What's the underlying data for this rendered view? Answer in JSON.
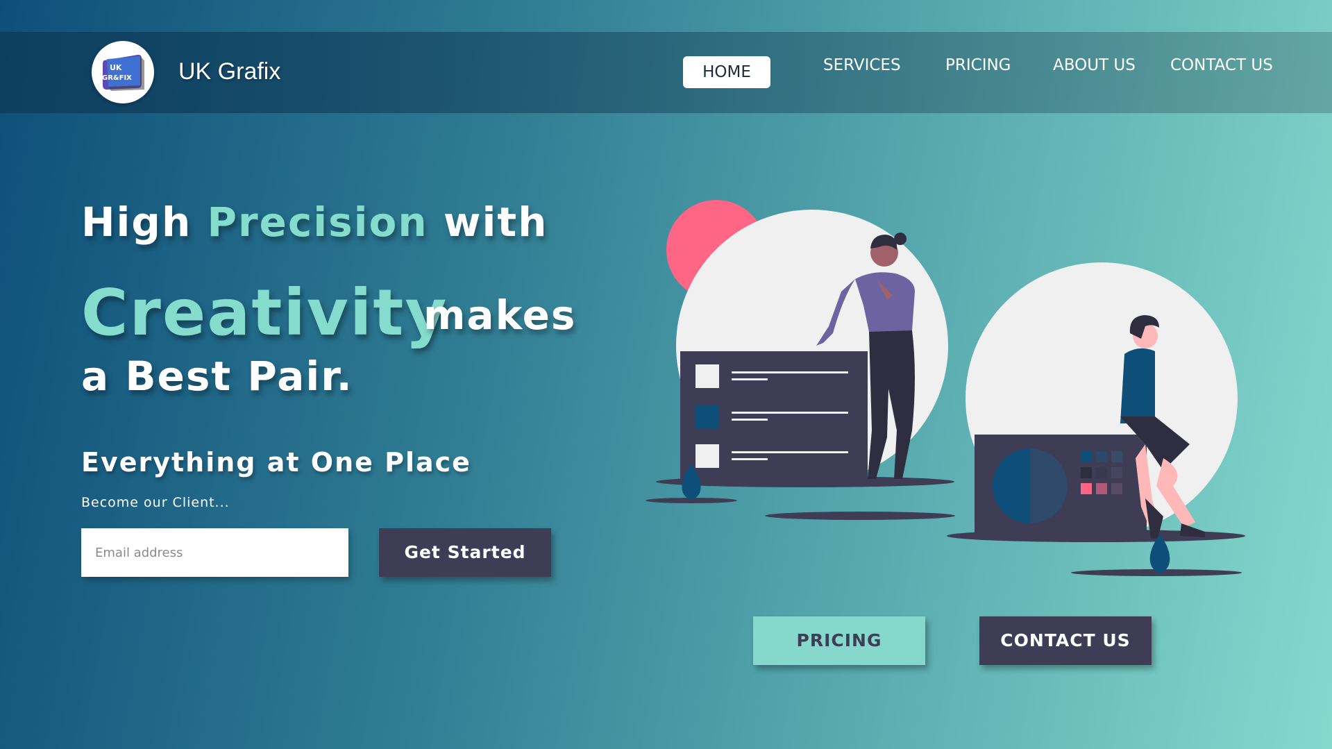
{
  "nav": {
    "brand": "UK Grafix",
    "logo_text_top": "UK",
    "logo_text_bottom": "GR&FIX",
    "items": [
      {
        "label": "HOME",
        "active": true
      },
      {
        "label": "SERVICES",
        "active": false
      },
      {
        "label": "PRICING",
        "active": false
      },
      {
        "label": "ABOUT US",
        "active": false
      },
      {
        "label": "CONTACT US",
        "active": false
      }
    ]
  },
  "hero": {
    "line1_a": "High",
    "line1_accent": "Precision",
    "line1_b": "with",
    "line2_accent": "Creativity",
    "line2_b": "makes",
    "line3": "a Best Pair.",
    "tagline": "Everything at One Place",
    "subtagline": "Become our Client...",
    "email_placeholder": "Email address",
    "cta_label": "Get Started"
  },
  "actions": {
    "pricing_label": "PRICING",
    "contact_label": "CONTACT US"
  },
  "colors": {
    "accent": "#86dccc",
    "dark": "#3f3d56",
    "pink": "#ff6584",
    "navy": "#0e4f79"
  }
}
